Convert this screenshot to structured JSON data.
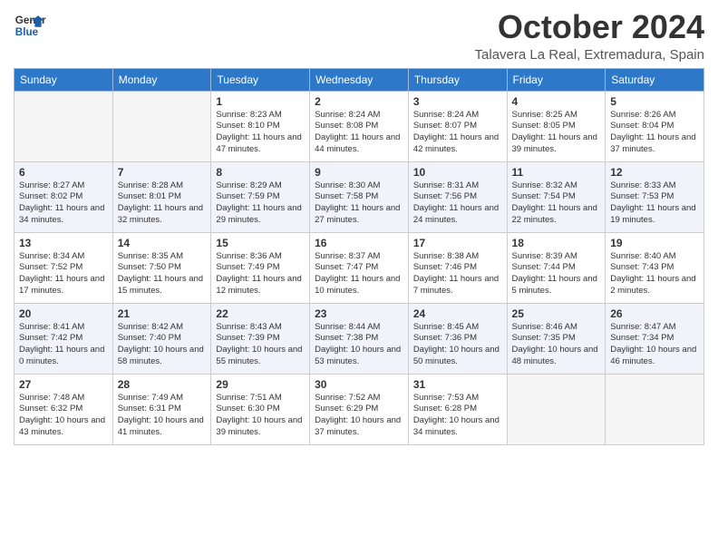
{
  "header": {
    "logo_line1": "General",
    "logo_line2": "Blue",
    "month": "October 2024",
    "subtitle": "Talavera La Real, Extremadura, Spain"
  },
  "weekdays": [
    "Sunday",
    "Monday",
    "Tuesday",
    "Wednesday",
    "Thursday",
    "Friday",
    "Saturday"
  ],
  "weeks": [
    [
      {
        "day": "",
        "empty": true
      },
      {
        "day": "",
        "empty": true
      },
      {
        "day": "1",
        "sunrise": "8:23 AM",
        "sunset": "8:10 PM",
        "daylight": "11 hours and 47 minutes."
      },
      {
        "day": "2",
        "sunrise": "8:24 AM",
        "sunset": "8:08 PM",
        "daylight": "11 hours and 44 minutes."
      },
      {
        "day": "3",
        "sunrise": "8:24 AM",
        "sunset": "8:07 PM",
        "daylight": "11 hours and 42 minutes."
      },
      {
        "day": "4",
        "sunrise": "8:25 AM",
        "sunset": "8:05 PM",
        "daylight": "11 hours and 39 minutes."
      },
      {
        "day": "5",
        "sunrise": "8:26 AM",
        "sunset": "8:04 PM",
        "daylight": "11 hours and 37 minutes."
      }
    ],
    [
      {
        "day": "6",
        "sunrise": "8:27 AM",
        "sunset": "8:02 PM",
        "daylight": "11 hours and 34 minutes."
      },
      {
        "day": "7",
        "sunrise": "8:28 AM",
        "sunset": "8:01 PM",
        "daylight": "11 hours and 32 minutes."
      },
      {
        "day": "8",
        "sunrise": "8:29 AM",
        "sunset": "7:59 PM",
        "daylight": "11 hours and 29 minutes."
      },
      {
        "day": "9",
        "sunrise": "8:30 AM",
        "sunset": "7:58 PM",
        "daylight": "11 hours and 27 minutes."
      },
      {
        "day": "10",
        "sunrise": "8:31 AM",
        "sunset": "7:56 PM",
        "daylight": "11 hours and 24 minutes."
      },
      {
        "day": "11",
        "sunrise": "8:32 AM",
        "sunset": "7:54 PM",
        "daylight": "11 hours and 22 minutes."
      },
      {
        "day": "12",
        "sunrise": "8:33 AM",
        "sunset": "7:53 PM",
        "daylight": "11 hours and 19 minutes."
      }
    ],
    [
      {
        "day": "13",
        "sunrise": "8:34 AM",
        "sunset": "7:52 PM",
        "daylight": "11 hours and 17 minutes."
      },
      {
        "day": "14",
        "sunrise": "8:35 AM",
        "sunset": "7:50 PM",
        "daylight": "11 hours and 15 minutes."
      },
      {
        "day": "15",
        "sunrise": "8:36 AM",
        "sunset": "7:49 PM",
        "daylight": "11 hours and 12 minutes."
      },
      {
        "day": "16",
        "sunrise": "8:37 AM",
        "sunset": "7:47 PM",
        "daylight": "11 hours and 10 minutes."
      },
      {
        "day": "17",
        "sunrise": "8:38 AM",
        "sunset": "7:46 PM",
        "daylight": "11 hours and 7 minutes."
      },
      {
        "day": "18",
        "sunrise": "8:39 AM",
        "sunset": "7:44 PM",
        "daylight": "11 hours and 5 minutes."
      },
      {
        "day": "19",
        "sunrise": "8:40 AM",
        "sunset": "7:43 PM",
        "daylight": "11 hours and 2 minutes."
      }
    ],
    [
      {
        "day": "20",
        "sunrise": "8:41 AM",
        "sunset": "7:42 PM",
        "daylight": "11 hours and 0 minutes."
      },
      {
        "day": "21",
        "sunrise": "8:42 AM",
        "sunset": "7:40 PM",
        "daylight": "10 hours and 58 minutes."
      },
      {
        "day": "22",
        "sunrise": "8:43 AM",
        "sunset": "7:39 PM",
        "daylight": "10 hours and 55 minutes."
      },
      {
        "day": "23",
        "sunrise": "8:44 AM",
        "sunset": "7:38 PM",
        "daylight": "10 hours and 53 minutes."
      },
      {
        "day": "24",
        "sunrise": "8:45 AM",
        "sunset": "7:36 PM",
        "daylight": "10 hours and 50 minutes."
      },
      {
        "day": "25",
        "sunrise": "8:46 AM",
        "sunset": "7:35 PM",
        "daylight": "10 hours and 48 minutes."
      },
      {
        "day": "26",
        "sunrise": "8:47 AM",
        "sunset": "7:34 PM",
        "daylight": "10 hours and 46 minutes."
      }
    ],
    [
      {
        "day": "27",
        "sunrise": "7:48 AM",
        "sunset": "6:32 PM",
        "daylight": "10 hours and 43 minutes."
      },
      {
        "day": "28",
        "sunrise": "7:49 AM",
        "sunset": "6:31 PM",
        "daylight": "10 hours and 41 minutes."
      },
      {
        "day": "29",
        "sunrise": "7:51 AM",
        "sunset": "6:30 PM",
        "daylight": "10 hours and 39 minutes."
      },
      {
        "day": "30",
        "sunrise": "7:52 AM",
        "sunset": "6:29 PM",
        "daylight": "10 hours and 37 minutes."
      },
      {
        "day": "31",
        "sunrise": "7:53 AM",
        "sunset": "6:28 PM",
        "daylight": "10 hours and 34 minutes."
      },
      {
        "day": "",
        "empty": true
      },
      {
        "day": "",
        "empty": true
      }
    ]
  ]
}
